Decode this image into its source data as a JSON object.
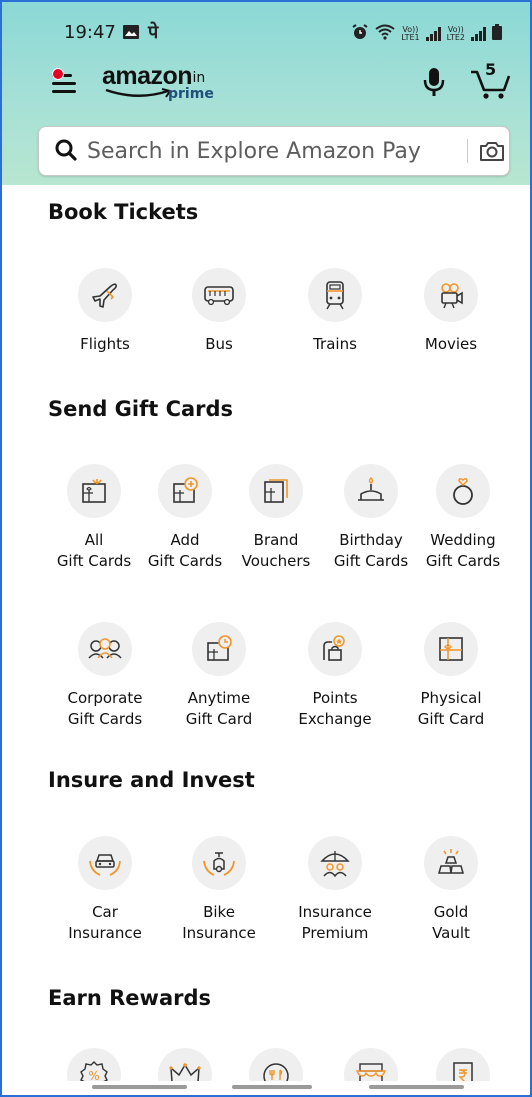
{
  "status_bar": {
    "time": "19:47",
    "carrier_glyph": "पे",
    "lte1": "LTE1",
    "lte2": "LTE2",
    "vo": "Vo))"
  },
  "header": {
    "logo_word": "amazon",
    "logo_tld": ".in",
    "logo_prime": "prime",
    "cart_count": "5",
    "icons": [
      "hamburger-menu-icon",
      "microphone-icon",
      "cart-icon"
    ]
  },
  "search": {
    "placeholder": "Search in Explore Amazon Pay",
    "icons": [
      "search-icon",
      "camera-icon"
    ]
  },
  "sections": {
    "book_tickets": {
      "title": "Book Tickets",
      "items": [
        {
          "label": "Flights",
          "icon": "plane-icon"
        },
        {
          "label": "Bus",
          "icon": "bus-icon"
        },
        {
          "label": "Trains",
          "icon": "train-icon"
        },
        {
          "label": "Movies",
          "icon": "movie-camera-icon"
        }
      ]
    },
    "gift_cards": {
      "title": "Send Gift Cards",
      "items": [
        {
          "label": "All\nGift Cards",
          "icon": "gift-card-icon"
        },
        {
          "label": "Add\nGift Cards",
          "icon": "add-gift-card-icon"
        },
        {
          "label": "Brand\nVouchers",
          "icon": "brand-voucher-icon"
        },
        {
          "label": "Birthday\nGift Cards",
          "icon": "birthday-cake-icon"
        },
        {
          "label": "Wedding\nGift Cards",
          "icon": "wedding-ring-icon"
        },
        {
          "label": "Corporate\nGift Cards",
          "icon": "corporate-people-icon"
        },
        {
          "label": "Anytime\nGift Card",
          "icon": "anytime-gift-card-icon"
        },
        {
          "label": "Points\nExchange",
          "icon": "points-exchange-icon"
        },
        {
          "label": "Physical\nGift Card",
          "icon": "physical-gift-card-icon"
        }
      ]
    },
    "insure": {
      "title": "Insure and Invest",
      "items": [
        {
          "label": "Car\nInsurance",
          "icon": "car-insurance-icon"
        },
        {
          "label": "Bike\nInsurance",
          "icon": "bike-insurance-icon"
        },
        {
          "label": "Insurance\nPremium",
          "icon": "umbrella-family-icon"
        },
        {
          "label": "Gold\nVault",
          "icon": "gold-bars-icon"
        }
      ]
    },
    "rewards": {
      "title": "Earn Rewards",
      "items": [
        {
          "label": "",
          "icon": "discount-badge-icon"
        },
        {
          "label": "",
          "icon": "crown-icon"
        },
        {
          "label": "",
          "icon": "dining-icon"
        },
        {
          "label": "",
          "icon": "store-icon"
        },
        {
          "label": "",
          "icon": "rupee-bill-icon"
        }
      ]
    }
  },
  "colors": {
    "accent": "#f0962a",
    "header_teal": "#8bd8d6",
    "tile_bg": "#efefef"
  }
}
